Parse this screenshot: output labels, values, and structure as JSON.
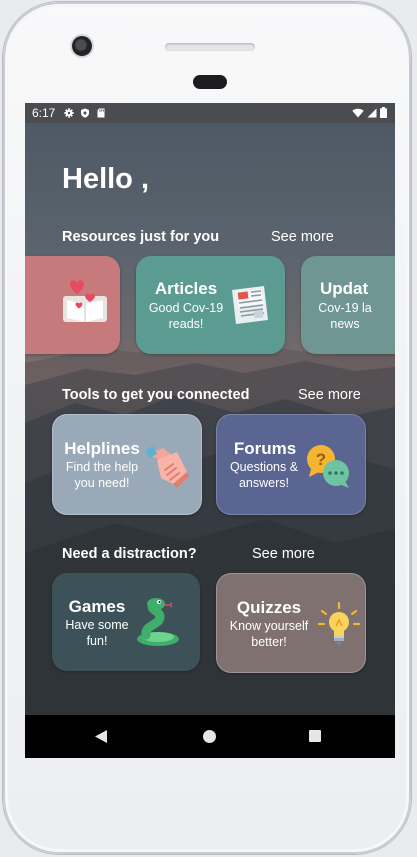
{
  "status_bar": {
    "time": "6:17",
    "left_icons": [
      "gear-icon",
      "shield-icon",
      "sd-card-icon"
    ],
    "right_icons": [
      "wifi-icon",
      "signal-icon",
      "battery-icon"
    ]
  },
  "greeting": "Hello ,",
  "sections": [
    {
      "title": "Resources just for you",
      "see_more": "See more",
      "cards": [
        {
          "title": "",
          "subtitle": "",
          "icon": "heart-book-icon",
          "color": "#c77a7b"
        },
        {
          "title": "Articles",
          "subtitle": "Good Cov-19 reads!",
          "icon": "newspaper-icon",
          "color": "#5b9b92"
        },
        {
          "title": "Updat",
          "subtitle": "Cov-19 la news",
          "icon": "",
          "color": "#6f9692"
        }
      ]
    },
    {
      "title": "Tools to get you connected",
      "see_more": "See more",
      "cards": [
        {
          "title": "Helplines",
          "subtitle": "Find the help you need!",
          "icon": "handshake-icon",
          "color": "#9aa9b8"
        },
        {
          "title": "Forums",
          "subtitle": "Questions & answers!",
          "icon": "chat-bubbles-icon",
          "color": "#5a6591"
        }
      ]
    },
    {
      "title": "Need a distraction?",
      "see_more": "See more",
      "cards": [
        {
          "title": "Games",
          "subtitle": "Have some fun!",
          "icon": "snake-icon",
          "color": "#3d5158"
        },
        {
          "title": "Quizzes",
          "subtitle": "Know yourself better!",
          "icon": "lightbulb-icon",
          "color": "#7f7170"
        }
      ]
    }
  ],
  "nav_bar": [
    "back-triangle-icon",
    "home-circle-icon",
    "recents-square-icon"
  ]
}
